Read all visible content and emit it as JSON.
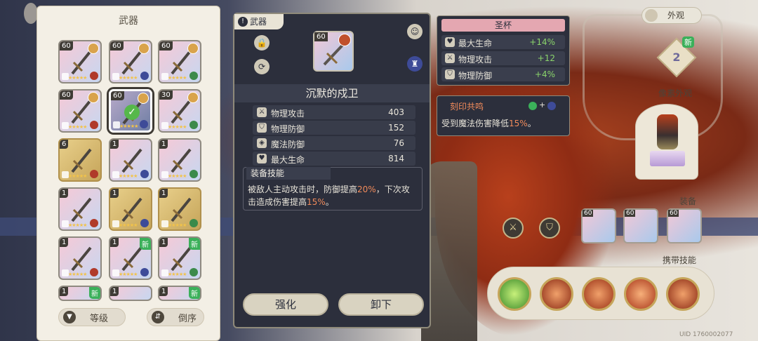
{
  "inventory": {
    "title": "武器",
    "tiles": [
      {
        "level": "60",
        "new": "",
        "style": "normal"
      },
      {
        "level": "60",
        "new": "",
        "style": "normal"
      },
      {
        "level": "60",
        "new": "",
        "style": "normal"
      },
      {
        "level": "60",
        "new": "",
        "style": "normal"
      },
      {
        "level": "60",
        "new": "",
        "style": "selected"
      },
      {
        "level": "30",
        "new": "",
        "style": "normal"
      },
      {
        "level": "6",
        "new": "",
        "style": "gold"
      },
      {
        "level": "1",
        "new": "",
        "style": "normal"
      },
      {
        "level": "1",
        "new": "",
        "style": "normal"
      },
      {
        "level": "1",
        "new": "",
        "style": "normal"
      },
      {
        "level": "1",
        "new": "",
        "style": "gold"
      },
      {
        "level": "1",
        "new": "",
        "style": "gold"
      },
      {
        "level": "1",
        "new": "",
        "style": "normal"
      },
      {
        "level": "1",
        "new": "新",
        "style": "normal"
      },
      {
        "level": "1",
        "new": "新",
        "style": "normal"
      },
      {
        "level": "1",
        "new": "新",
        "style": "normal"
      },
      {
        "level": "1",
        "new": "",
        "style": "normal"
      },
      {
        "level": "1",
        "new": "新",
        "style": "normal"
      }
    ],
    "sort_level_label": "等级",
    "sort_order_label": "倒序"
  },
  "detail": {
    "tag": "武器",
    "level": "60",
    "name": "沉默的戍卫",
    "stats": [
      {
        "icon": "sword-icon",
        "label": "物理攻击",
        "value": "403"
      },
      {
        "icon": "shield-icon",
        "label": "物理防御",
        "value": "152"
      },
      {
        "icon": "magic-shield-icon",
        "label": "魔法防御",
        "value": "76"
      },
      {
        "icon": "heart-icon",
        "label": "最大生命",
        "value": "814"
      }
    ],
    "skill_title": "装备技能",
    "skill_text_1": "被敌人主动攻击时，防御提高",
    "skill_pct_1": "20%",
    "skill_text_2": "，下次攻击造成伤害提高",
    "skill_pct_2": "15%",
    "skill_text_3": "。",
    "enhance_label": "强化",
    "unequip_label": "卸下"
  },
  "grail": {
    "title": "圣杯",
    "stats": [
      {
        "label": "最大生命",
        "value": "+14%"
      },
      {
        "label": "物理攻击",
        "value": "+12"
      },
      {
        "label": "物理防御",
        "value": "+4%"
      }
    ]
  },
  "imprint": {
    "title": "刻印共鸣",
    "plus": "+",
    "desc_1": "受到魔法伤害降低",
    "desc_pct": "15%",
    "desc_2": "。"
  },
  "right": {
    "appearance_label": "外观",
    "rank": "2",
    "rank_new": "新",
    "pixel_label": "像素外观",
    "equip_label": "装备",
    "equip_levels": [
      "60",
      "60",
      "60"
    ],
    "carry_skill_label": "携带技能",
    "uid": "UID 1760002077"
  },
  "colors": {
    "highlight": "#f08a5a",
    "positive": "#8ad36b",
    "new_badge": "#3bb05a"
  }
}
